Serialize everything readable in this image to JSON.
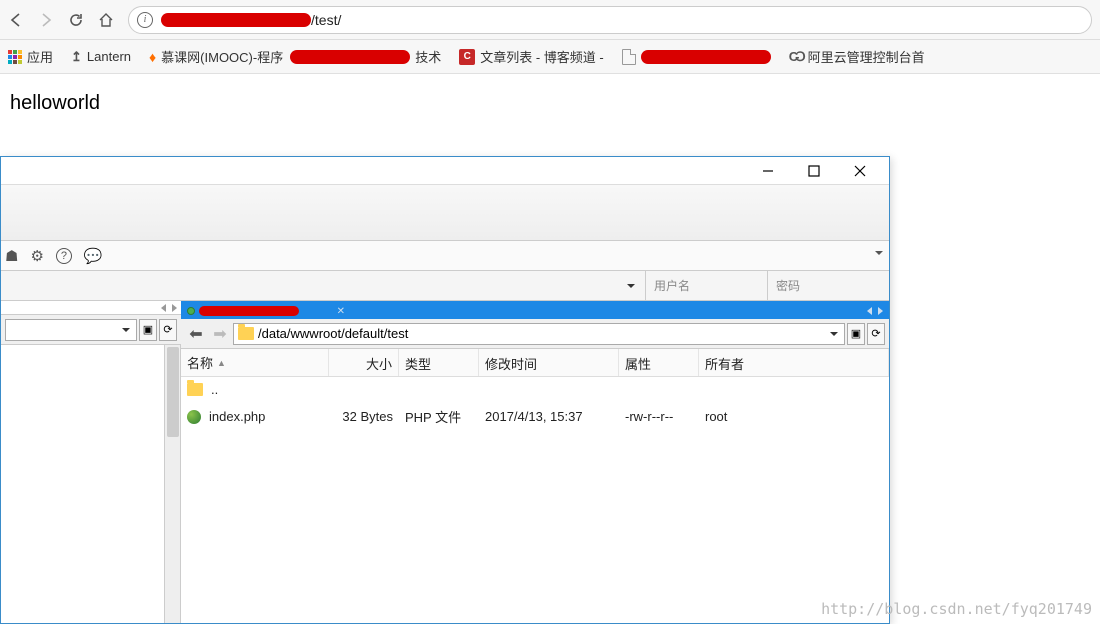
{
  "browser": {
    "url_suffix": "/test/",
    "bookmarks": {
      "apps": "应用",
      "lantern": "Lantern",
      "imooc": "慕课网(IMOOC)-程序",
      "tech_suffix": "技术",
      "blog": "文章列表 - 博客频道 -",
      "aliyun": "阿里云管理控制台首"
    }
  },
  "page": {
    "content": "helloworld"
  },
  "ftp": {
    "cred": {
      "user_ph": "用户名",
      "pass_ph": "密码"
    },
    "remote_path": "/data/wwwroot/default/test",
    "columns": {
      "name": "名称",
      "size": "大小",
      "type": "类型",
      "date": "修改时间",
      "attr": "属性",
      "owner": "所有者"
    },
    "parent_row": "..",
    "file": {
      "name": "index.php",
      "size": "32 Bytes",
      "type": "PHP 文件",
      "date": "2017/4/13, 15:37",
      "attr": "-rw-r--r--",
      "owner": "root"
    }
  },
  "watermark": "http://blog.csdn.net/fyq201749"
}
